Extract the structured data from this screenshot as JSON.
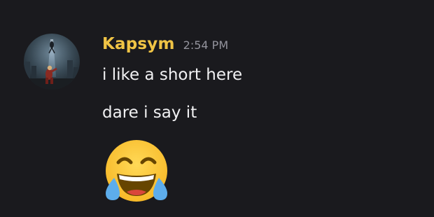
{
  "message": {
    "author": "Kapsym",
    "timestamp": "2:54 PM",
    "lines": [
      "i like a short here",
      "dare i say it"
    ],
    "emoji": "face-with-tears-of-joy-icon"
  },
  "colors": {
    "background": "#1a1a1e",
    "username": "#f0c445",
    "timestamp": "#93939c",
    "text": "#f1f1f3"
  },
  "icons": {
    "avatar": "avatar-image"
  }
}
